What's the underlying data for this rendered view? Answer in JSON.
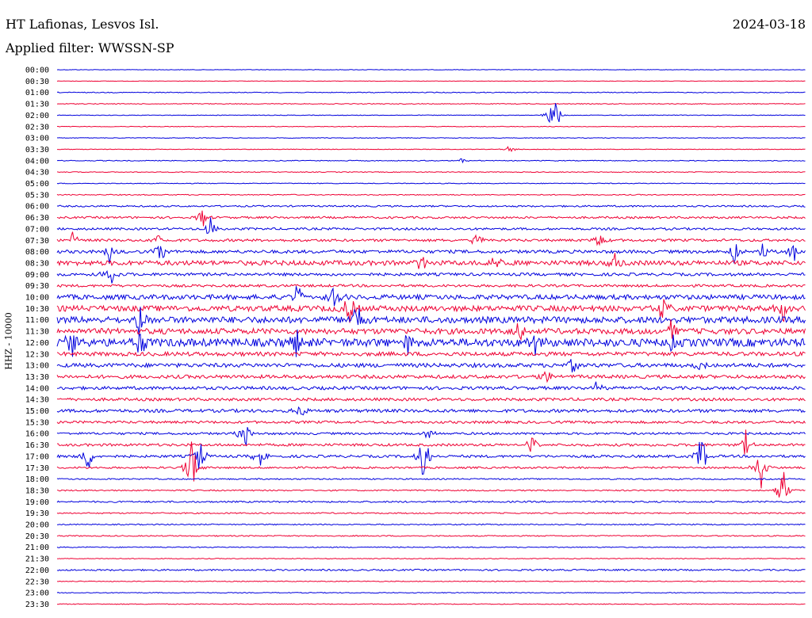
{
  "header": {
    "station": "HT Lafionas, Lesvos Isl.",
    "date": "2024-03-18",
    "filter": "Applied filter: WWSSN-SP"
  },
  "chart_data": {
    "type": "line",
    "title": "HT Lafionas, Lesvos Isl.",
    "subtitle": "Applied filter: WWSSN-SP",
    "date": "2024-03-18",
    "ylabel": "HHZ - 10000",
    "xlabel": "",
    "row_labels": [
      "00:00",
      "00:30",
      "01:00",
      "01:30",
      "02:00",
      "02:30",
      "03:00",
      "03:30",
      "04:00",
      "04:30",
      "05:00",
      "05:30",
      "06:00",
      "06:30",
      "07:00",
      "07:30",
      "08:00",
      "08:30",
      "09:00",
      "09:30",
      "10:00",
      "10:30",
      "11:00",
      "11:30",
      "12:00",
      "12:30",
      "13:00",
      "13:30",
      "14:00",
      "14:30",
      "15:00",
      "15:30",
      "16:00",
      "16:30",
      "17:00",
      "17:30",
      "18:00",
      "18:30",
      "19:00",
      "19:30",
      "20:00",
      "20:30",
      "21:00",
      "21:30",
      "22:00",
      "22:30",
      "23:00",
      "23:30"
    ],
    "series_colors": [
      "#0000dd",
      "#ee0033"
    ],
    "noise_level": [
      0.3,
      0.3,
      0.5,
      0.5,
      0.4,
      0.4,
      0.4,
      0.4,
      0.5,
      0.5,
      0.5,
      0.6,
      1.0,
      1.3,
      1.4,
      1.6,
      2.0,
      3.0,
      1.8,
      1.6,
      3.0,
      3.5,
      4.0,
      3.5,
      5.0,
      2.5,
      2.5,
      2.2,
      2.0,
      1.8,
      2.0,
      1.6,
      1.4,
      1.6,
      1.6,
      1.2,
      0.8,
      0.8,
      1.0,
      0.8,
      0.7,
      0.7,
      0.6,
      0.5,
      1.0,
      0.5,
      0.5,
      0.5
    ],
    "events": [
      {
        "row": 4,
        "x": 0.665,
        "amp": 45
      },
      {
        "row": 7,
        "x": 0.605,
        "amp": 6
      },
      {
        "row": 8,
        "x": 0.54,
        "amp": 4
      },
      {
        "row": 13,
        "x": 0.195,
        "amp": 14
      },
      {
        "row": 14,
        "x": 0.205,
        "amp": 16
      },
      {
        "row": 15,
        "x": 0.02,
        "amp": 14
      },
      {
        "row": 15,
        "x": 0.135,
        "amp": 10
      },
      {
        "row": 15,
        "x": 0.56,
        "amp": 12
      },
      {
        "row": 15,
        "x": 0.725,
        "amp": 14
      },
      {
        "row": 16,
        "x": 0.07,
        "amp": 18
      },
      {
        "row": 16,
        "x": 0.137,
        "amp": 22
      },
      {
        "row": 16,
        "x": 0.905,
        "amp": 18
      },
      {
        "row": 16,
        "x": 0.945,
        "amp": 16
      },
      {
        "row": 16,
        "x": 0.985,
        "amp": 16
      },
      {
        "row": 17,
        "x": 0.745,
        "amp": 18
      },
      {
        "row": 17,
        "x": 0.485,
        "amp": 16
      },
      {
        "row": 17,
        "x": 0.585,
        "amp": 18
      },
      {
        "row": 18,
        "x": 0.07,
        "amp": 22
      },
      {
        "row": 20,
        "x": 0.32,
        "amp": 20
      },
      {
        "row": 20,
        "x": 0.37,
        "amp": 22
      },
      {
        "row": 21,
        "x": 0.39,
        "amp": 24
      },
      {
        "row": 21,
        "x": 0.81,
        "amp": 20
      },
      {
        "row": 21,
        "x": 0.97,
        "amp": 18
      },
      {
        "row": 22,
        "x": 0.11,
        "amp": 26
      },
      {
        "row": 22,
        "x": 0.4,
        "amp": 26
      },
      {
        "row": 23,
        "x": 0.62,
        "amp": 22
      },
      {
        "row": 23,
        "x": 0.82,
        "amp": 24
      },
      {
        "row": 24,
        "x": 0.02,
        "amp": 24
      },
      {
        "row": 24,
        "x": 0.11,
        "amp": 22
      },
      {
        "row": 24,
        "x": 0.32,
        "amp": 20
      },
      {
        "row": 24,
        "x": 0.47,
        "amp": 24
      },
      {
        "row": 24,
        "x": 0.64,
        "amp": 18
      },
      {
        "row": 24,
        "x": 0.82,
        "amp": 18
      },
      {
        "row": 26,
        "x": 0.69,
        "amp": 14
      },
      {
        "row": 26,
        "x": 0.86,
        "amp": 14
      },
      {
        "row": 27,
        "x": 0.655,
        "amp": 10
      },
      {
        "row": 28,
        "x": 0.72,
        "amp": 10
      },
      {
        "row": 30,
        "x": 0.325,
        "amp": 12
      },
      {
        "row": 32,
        "x": 0.25,
        "amp": 22
      },
      {
        "row": 32,
        "x": 0.495,
        "amp": 10
      },
      {
        "row": 33,
        "x": 0.635,
        "amp": 14
      },
      {
        "row": 33,
        "x": 0.92,
        "amp": 18
      },
      {
        "row": 34,
        "x": 0.04,
        "amp": 26
      },
      {
        "row": 34,
        "x": 0.19,
        "amp": 26
      },
      {
        "row": 34,
        "x": 0.27,
        "amp": 20
      },
      {
        "row": 34,
        "x": 0.49,
        "amp": 38
      },
      {
        "row": 34,
        "x": 0.86,
        "amp": 40
      },
      {
        "row": 35,
        "x": 0.18,
        "amp": 48
      },
      {
        "row": 35,
        "x": 0.94,
        "amp": 30
      },
      {
        "row": 37,
        "x": 0.97,
        "amp": 42
      }
    ]
  }
}
